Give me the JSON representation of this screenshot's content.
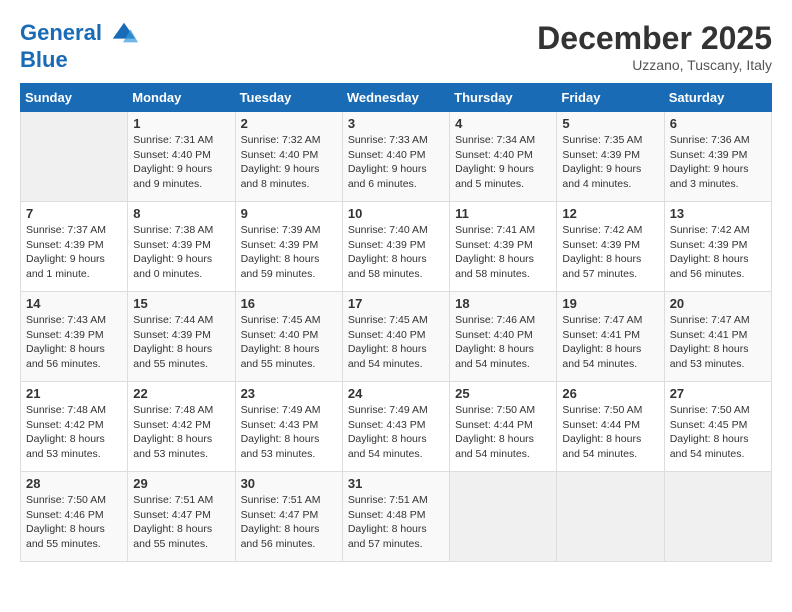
{
  "header": {
    "logo_line1": "General",
    "logo_line2": "Blue",
    "month_title": "December 2025",
    "location": "Uzzano, Tuscany, Italy"
  },
  "weekdays": [
    "Sunday",
    "Monday",
    "Tuesday",
    "Wednesday",
    "Thursday",
    "Friday",
    "Saturday"
  ],
  "weeks": [
    [
      {
        "day": "",
        "info": ""
      },
      {
        "day": "1",
        "info": "Sunrise: 7:31 AM\nSunset: 4:40 PM\nDaylight: 9 hours\nand 9 minutes."
      },
      {
        "day": "2",
        "info": "Sunrise: 7:32 AM\nSunset: 4:40 PM\nDaylight: 9 hours\nand 8 minutes."
      },
      {
        "day": "3",
        "info": "Sunrise: 7:33 AM\nSunset: 4:40 PM\nDaylight: 9 hours\nand 6 minutes."
      },
      {
        "day": "4",
        "info": "Sunrise: 7:34 AM\nSunset: 4:40 PM\nDaylight: 9 hours\nand 5 minutes."
      },
      {
        "day": "5",
        "info": "Sunrise: 7:35 AM\nSunset: 4:39 PM\nDaylight: 9 hours\nand 4 minutes."
      },
      {
        "day": "6",
        "info": "Sunrise: 7:36 AM\nSunset: 4:39 PM\nDaylight: 9 hours\nand 3 minutes."
      }
    ],
    [
      {
        "day": "7",
        "info": "Sunrise: 7:37 AM\nSunset: 4:39 PM\nDaylight: 9 hours\nand 1 minute."
      },
      {
        "day": "8",
        "info": "Sunrise: 7:38 AM\nSunset: 4:39 PM\nDaylight: 9 hours\nand 0 minutes."
      },
      {
        "day": "9",
        "info": "Sunrise: 7:39 AM\nSunset: 4:39 PM\nDaylight: 8 hours\nand 59 minutes."
      },
      {
        "day": "10",
        "info": "Sunrise: 7:40 AM\nSunset: 4:39 PM\nDaylight: 8 hours\nand 58 minutes."
      },
      {
        "day": "11",
        "info": "Sunrise: 7:41 AM\nSunset: 4:39 PM\nDaylight: 8 hours\nand 58 minutes."
      },
      {
        "day": "12",
        "info": "Sunrise: 7:42 AM\nSunset: 4:39 PM\nDaylight: 8 hours\nand 57 minutes."
      },
      {
        "day": "13",
        "info": "Sunrise: 7:42 AM\nSunset: 4:39 PM\nDaylight: 8 hours\nand 56 minutes."
      }
    ],
    [
      {
        "day": "14",
        "info": "Sunrise: 7:43 AM\nSunset: 4:39 PM\nDaylight: 8 hours\nand 56 minutes."
      },
      {
        "day": "15",
        "info": "Sunrise: 7:44 AM\nSunset: 4:39 PM\nDaylight: 8 hours\nand 55 minutes."
      },
      {
        "day": "16",
        "info": "Sunrise: 7:45 AM\nSunset: 4:40 PM\nDaylight: 8 hours\nand 55 minutes."
      },
      {
        "day": "17",
        "info": "Sunrise: 7:45 AM\nSunset: 4:40 PM\nDaylight: 8 hours\nand 54 minutes."
      },
      {
        "day": "18",
        "info": "Sunrise: 7:46 AM\nSunset: 4:40 PM\nDaylight: 8 hours\nand 54 minutes."
      },
      {
        "day": "19",
        "info": "Sunrise: 7:47 AM\nSunset: 4:41 PM\nDaylight: 8 hours\nand 54 minutes."
      },
      {
        "day": "20",
        "info": "Sunrise: 7:47 AM\nSunset: 4:41 PM\nDaylight: 8 hours\nand 53 minutes."
      }
    ],
    [
      {
        "day": "21",
        "info": "Sunrise: 7:48 AM\nSunset: 4:42 PM\nDaylight: 8 hours\nand 53 minutes."
      },
      {
        "day": "22",
        "info": "Sunrise: 7:48 AM\nSunset: 4:42 PM\nDaylight: 8 hours\nand 53 minutes."
      },
      {
        "day": "23",
        "info": "Sunrise: 7:49 AM\nSunset: 4:43 PM\nDaylight: 8 hours\nand 53 minutes."
      },
      {
        "day": "24",
        "info": "Sunrise: 7:49 AM\nSunset: 4:43 PM\nDaylight: 8 hours\nand 54 minutes."
      },
      {
        "day": "25",
        "info": "Sunrise: 7:50 AM\nSunset: 4:44 PM\nDaylight: 8 hours\nand 54 minutes."
      },
      {
        "day": "26",
        "info": "Sunrise: 7:50 AM\nSunset: 4:44 PM\nDaylight: 8 hours\nand 54 minutes."
      },
      {
        "day": "27",
        "info": "Sunrise: 7:50 AM\nSunset: 4:45 PM\nDaylight: 8 hours\nand 54 minutes."
      }
    ],
    [
      {
        "day": "28",
        "info": "Sunrise: 7:50 AM\nSunset: 4:46 PM\nDaylight: 8 hours\nand 55 minutes."
      },
      {
        "day": "29",
        "info": "Sunrise: 7:51 AM\nSunset: 4:47 PM\nDaylight: 8 hours\nand 55 minutes."
      },
      {
        "day": "30",
        "info": "Sunrise: 7:51 AM\nSunset: 4:47 PM\nDaylight: 8 hours\nand 56 minutes."
      },
      {
        "day": "31",
        "info": "Sunrise: 7:51 AM\nSunset: 4:48 PM\nDaylight: 8 hours\nand 57 minutes."
      },
      {
        "day": "",
        "info": ""
      },
      {
        "day": "",
        "info": ""
      },
      {
        "day": "",
        "info": ""
      }
    ]
  ]
}
